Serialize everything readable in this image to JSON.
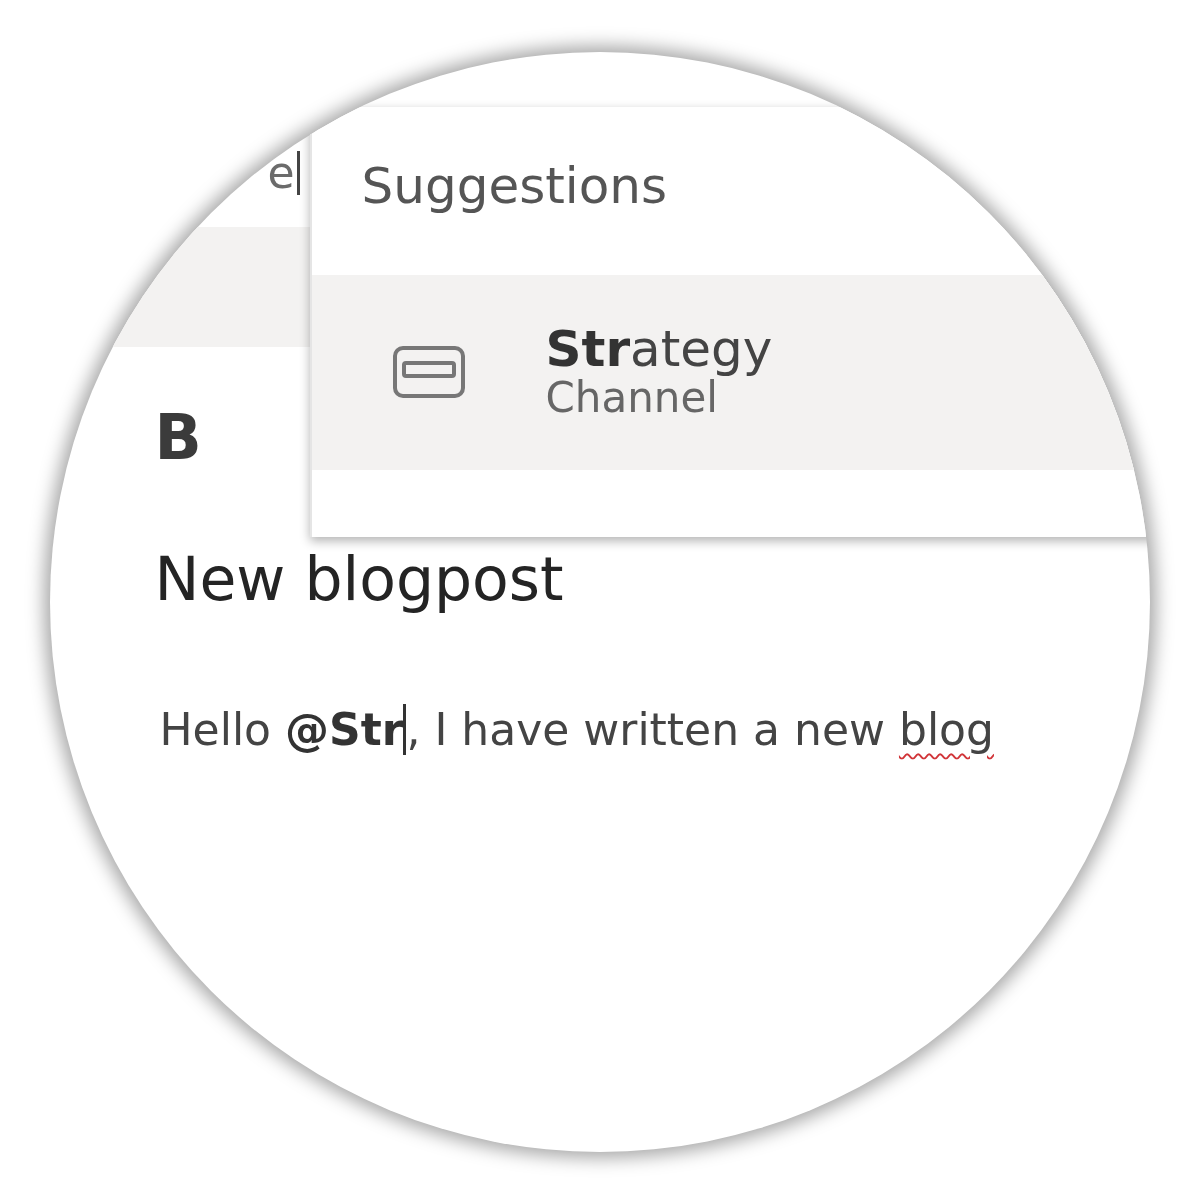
{
  "reply_field": {
    "text": "e"
  },
  "toolbar": {
    "bold_button": {
      "label": "B"
    }
  },
  "suggestions": {
    "title": "Suggestions",
    "items": [
      {
        "name": "**Str**ategy",
        "type": "Channel",
        "selected": true
      }
    ]
  },
  "editor": {
    "title": "New blogpost",
    "body": {
      "before_cursor": "Hello **@Str**",
      "after_cursor": ", I have written a new ",
      "misspelled": "blog"
    }
  }
}
